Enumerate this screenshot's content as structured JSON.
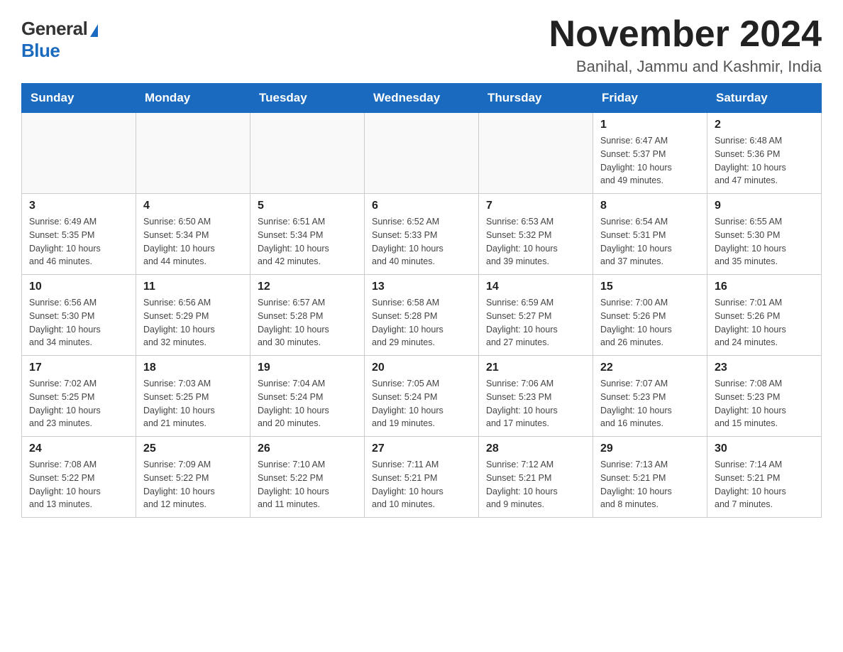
{
  "logo": {
    "general": "General",
    "blue": "Blue"
  },
  "title": "November 2024",
  "location": "Banihal, Jammu and Kashmir, India",
  "days_of_week": [
    "Sunday",
    "Monday",
    "Tuesday",
    "Wednesday",
    "Thursday",
    "Friday",
    "Saturday"
  ],
  "weeks": [
    [
      {
        "day": "",
        "info": ""
      },
      {
        "day": "",
        "info": ""
      },
      {
        "day": "",
        "info": ""
      },
      {
        "day": "",
        "info": ""
      },
      {
        "day": "",
        "info": ""
      },
      {
        "day": "1",
        "info": "Sunrise: 6:47 AM\nSunset: 5:37 PM\nDaylight: 10 hours\nand 49 minutes."
      },
      {
        "day": "2",
        "info": "Sunrise: 6:48 AM\nSunset: 5:36 PM\nDaylight: 10 hours\nand 47 minutes."
      }
    ],
    [
      {
        "day": "3",
        "info": "Sunrise: 6:49 AM\nSunset: 5:35 PM\nDaylight: 10 hours\nand 46 minutes."
      },
      {
        "day": "4",
        "info": "Sunrise: 6:50 AM\nSunset: 5:34 PM\nDaylight: 10 hours\nand 44 minutes."
      },
      {
        "day": "5",
        "info": "Sunrise: 6:51 AM\nSunset: 5:34 PM\nDaylight: 10 hours\nand 42 minutes."
      },
      {
        "day": "6",
        "info": "Sunrise: 6:52 AM\nSunset: 5:33 PM\nDaylight: 10 hours\nand 40 minutes."
      },
      {
        "day": "7",
        "info": "Sunrise: 6:53 AM\nSunset: 5:32 PM\nDaylight: 10 hours\nand 39 minutes."
      },
      {
        "day": "8",
        "info": "Sunrise: 6:54 AM\nSunset: 5:31 PM\nDaylight: 10 hours\nand 37 minutes."
      },
      {
        "day": "9",
        "info": "Sunrise: 6:55 AM\nSunset: 5:30 PM\nDaylight: 10 hours\nand 35 minutes."
      }
    ],
    [
      {
        "day": "10",
        "info": "Sunrise: 6:56 AM\nSunset: 5:30 PM\nDaylight: 10 hours\nand 34 minutes."
      },
      {
        "day": "11",
        "info": "Sunrise: 6:56 AM\nSunset: 5:29 PM\nDaylight: 10 hours\nand 32 minutes."
      },
      {
        "day": "12",
        "info": "Sunrise: 6:57 AM\nSunset: 5:28 PM\nDaylight: 10 hours\nand 30 minutes."
      },
      {
        "day": "13",
        "info": "Sunrise: 6:58 AM\nSunset: 5:28 PM\nDaylight: 10 hours\nand 29 minutes."
      },
      {
        "day": "14",
        "info": "Sunrise: 6:59 AM\nSunset: 5:27 PM\nDaylight: 10 hours\nand 27 minutes."
      },
      {
        "day": "15",
        "info": "Sunrise: 7:00 AM\nSunset: 5:26 PM\nDaylight: 10 hours\nand 26 minutes."
      },
      {
        "day": "16",
        "info": "Sunrise: 7:01 AM\nSunset: 5:26 PM\nDaylight: 10 hours\nand 24 minutes."
      }
    ],
    [
      {
        "day": "17",
        "info": "Sunrise: 7:02 AM\nSunset: 5:25 PM\nDaylight: 10 hours\nand 23 minutes."
      },
      {
        "day": "18",
        "info": "Sunrise: 7:03 AM\nSunset: 5:25 PM\nDaylight: 10 hours\nand 21 minutes."
      },
      {
        "day": "19",
        "info": "Sunrise: 7:04 AM\nSunset: 5:24 PM\nDaylight: 10 hours\nand 20 minutes."
      },
      {
        "day": "20",
        "info": "Sunrise: 7:05 AM\nSunset: 5:24 PM\nDaylight: 10 hours\nand 19 minutes."
      },
      {
        "day": "21",
        "info": "Sunrise: 7:06 AM\nSunset: 5:23 PM\nDaylight: 10 hours\nand 17 minutes."
      },
      {
        "day": "22",
        "info": "Sunrise: 7:07 AM\nSunset: 5:23 PM\nDaylight: 10 hours\nand 16 minutes."
      },
      {
        "day": "23",
        "info": "Sunrise: 7:08 AM\nSunset: 5:23 PM\nDaylight: 10 hours\nand 15 minutes."
      }
    ],
    [
      {
        "day": "24",
        "info": "Sunrise: 7:08 AM\nSunset: 5:22 PM\nDaylight: 10 hours\nand 13 minutes."
      },
      {
        "day": "25",
        "info": "Sunrise: 7:09 AM\nSunset: 5:22 PM\nDaylight: 10 hours\nand 12 minutes."
      },
      {
        "day": "26",
        "info": "Sunrise: 7:10 AM\nSunset: 5:22 PM\nDaylight: 10 hours\nand 11 minutes."
      },
      {
        "day": "27",
        "info": "Sunrise: 7:11 AM\nSunset: 5:21 PM\nDaylight: 10 hours\nand 10 minutes."
      },
      {
        "day": "28",
        "info": "Sunrise: 7:12 AM\nSunset: 5:21 PM\nDaylight: 10 hours\nand 9 minutes."
      },
      {
        "day": "29",
        "info": "Sunrise: 7:13 AM\nSunset: 5:21 PM\nDaylight: 10 hours\nand 8 minutes."
      },
      {
        "day": "30",
        "info": "Sunrise: 7:14 AM\nSunset: 5:21 PM\nDaylight: 10 hours\nand 7 minutes."
      }
    ]
  ]
}
